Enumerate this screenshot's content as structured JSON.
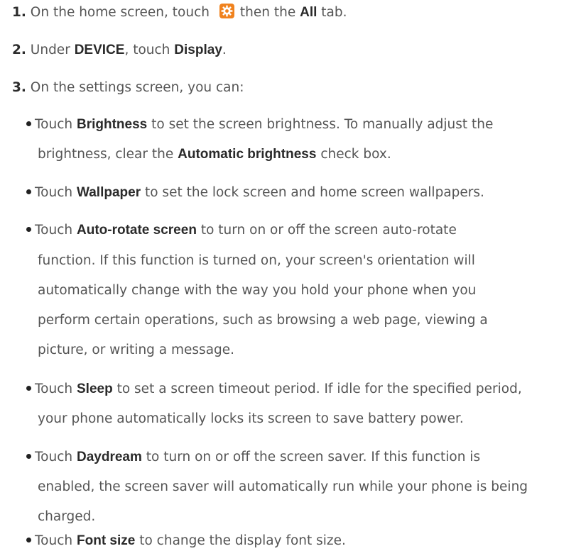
{
  "steps": [
    {
      "num": "1.",
      "t1": "On the home screen, touch",
      "t2": "then the",
      "b1": "All",
      "t3": "tab.",
      "icon": "settings-gear-icon"
    },
    {
      "num": "2.",
      "t1": "Under",
      "b1": "DEVICE",
      "t2": ", touch",
      "b2": "Display",
      "t3": "."
    },
    {
      "num": "3.",
      "t1": "On the settings screen, you can:"
    }
  ],
  "bullets": [
    {
      "pre": "Touch",
      "b1": "Brightness",
      "t1": "to set the screen brightness. To manually adjust the",
      "l2a": "brightness, clear the",
      "b2": "Automatic brightness",
      "l2b": "check box."
    },
    {
      "pre": "Touch",
      "b1": "Wallpaper",
      "t1": "to set the lock screen and home screen wallpapers."
    },
    {
      "pre": "Touch",
      "b1": "Auto-rotate screen",
      "t1": "to turn on or off the screen auto-rotate",
      "l2": "function. If this function is turned on, your screen's orientation will",
      "l3": "automatically change with the way you hold your phone when you",
      "l4": "perform certain operations, such as browsing a web page, viewing a",
      "l5": "picture, or writing a message."
    },
    {
      "pre": "Touch",
      "b1": "Sleep",
      "t1": "to set a screen timeout period. If idle for the specified period,",
      "l2": "your phone automatically locks its screen to save battery power."
    },
    {
      "pre": "Touch",
      "b1": "Daydream",
      "t1": "to turn on or off the screen saver. If this function is",
      "l2": "enabled, the screen saver will automatically run while your phone is being",
      "l3": "charged."
    },
    {
      "pre": "Touch",
      "b1": "Font size",
      "t1": "to change the display font size."
    }
  ],
  "colors": {
    "text": "#555555",
    "bold": "#2a2a2a",
    "icon_orange": "#f0821e"
  }
}
